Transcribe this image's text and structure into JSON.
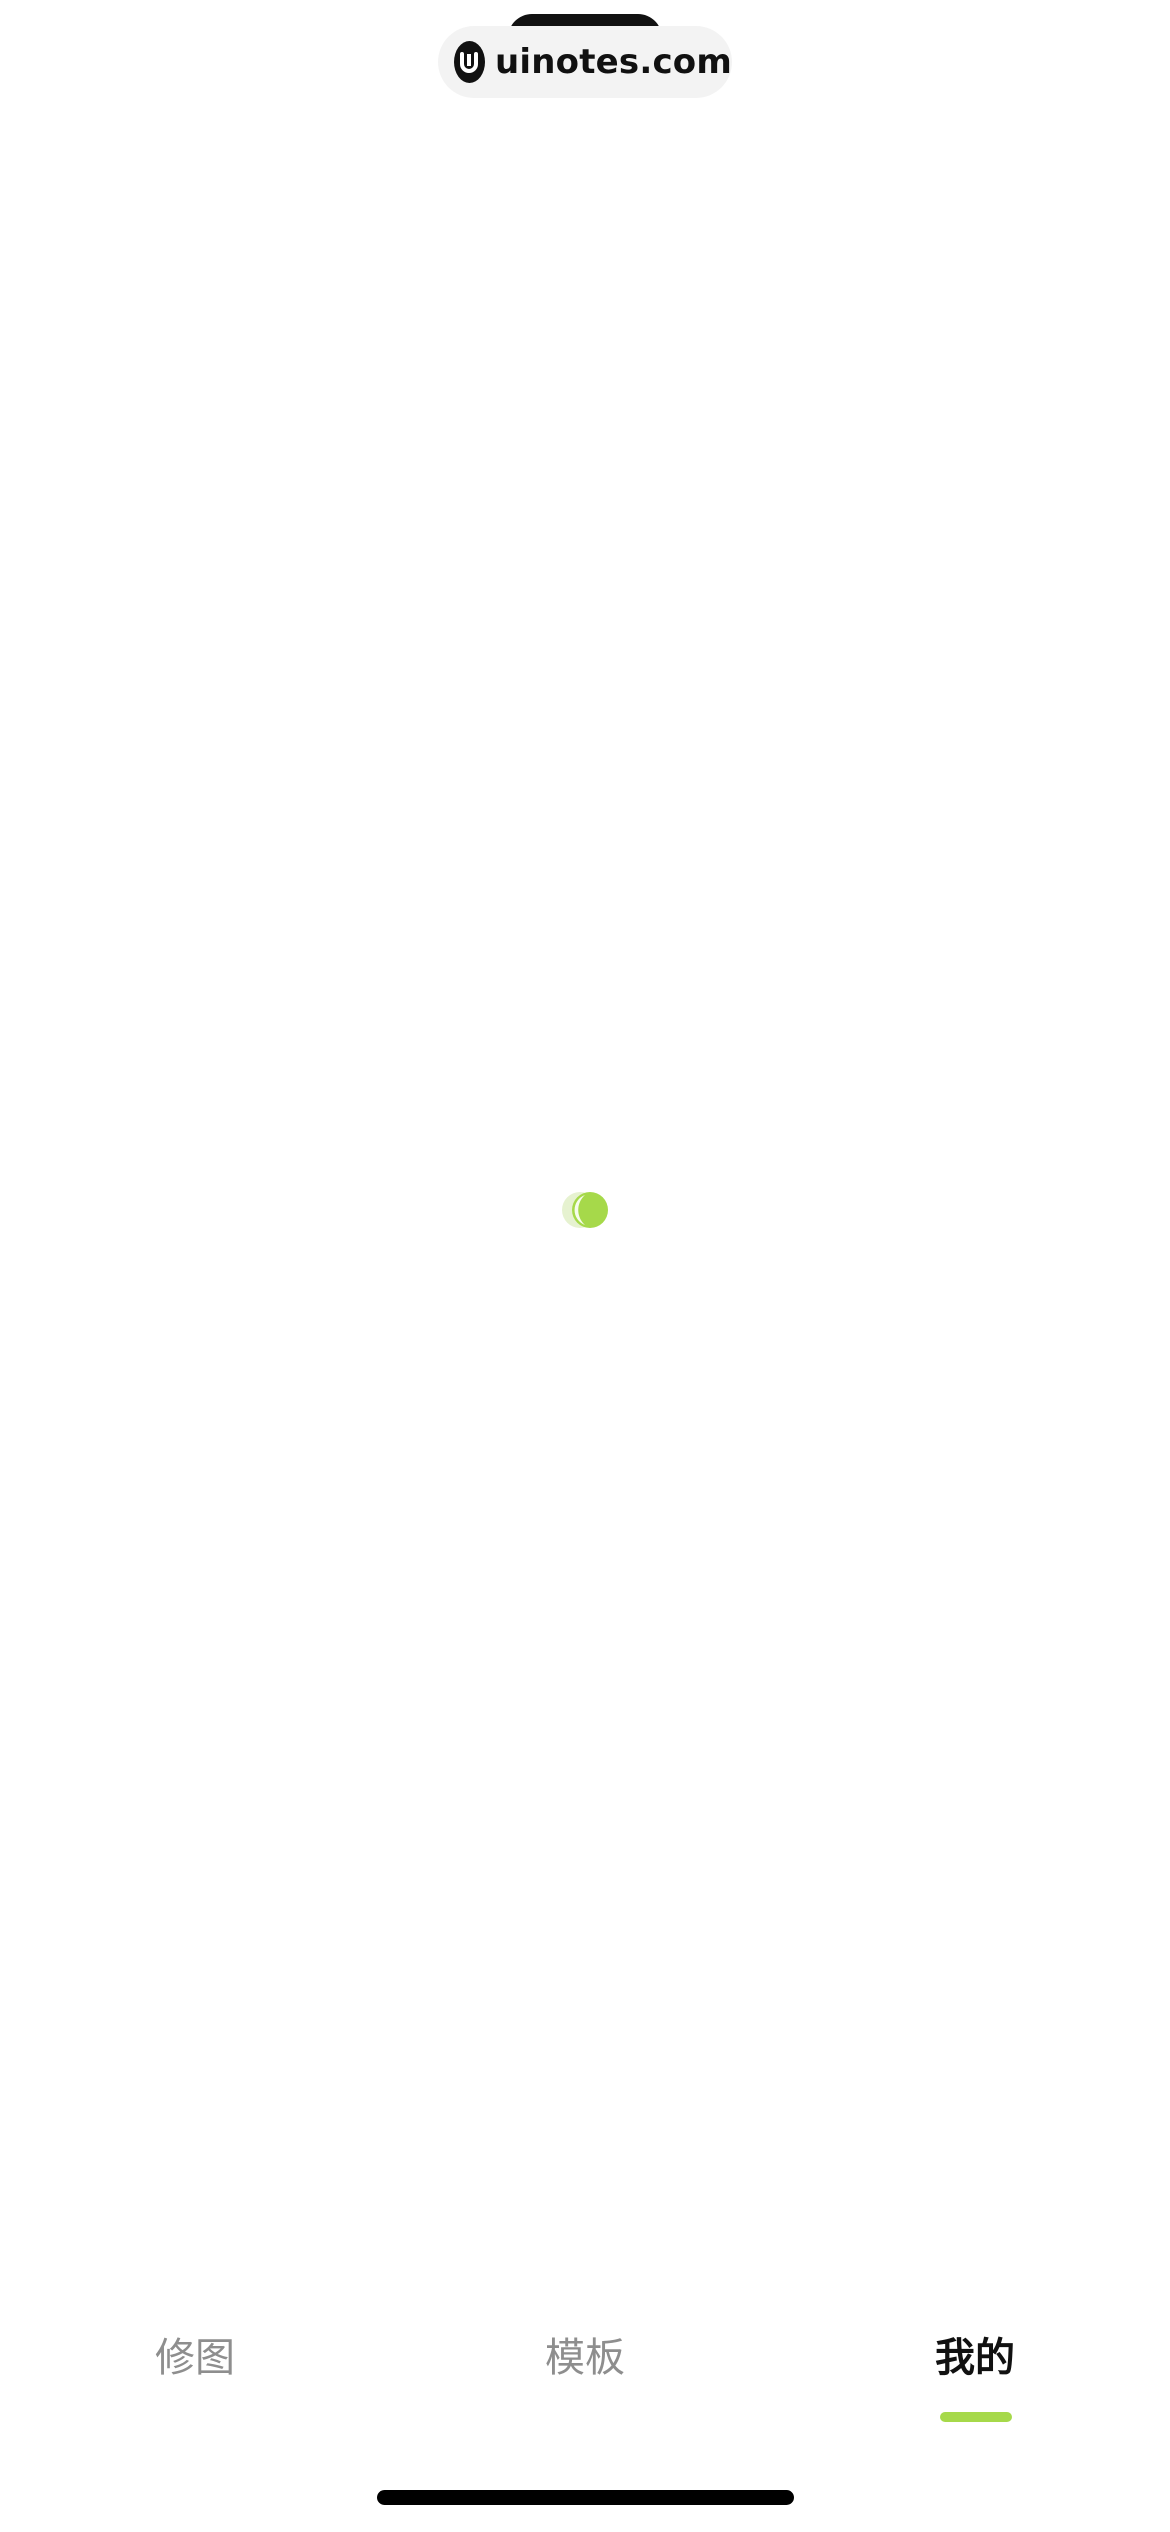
{
  "watermark": {
    "text": "uinotes.com"
  },
  "tabbar": {
    "tabs": [
      {
        "label": "修图",
        "active": false
      },
      {
        "label": "模板",
        "active": false
      },
      {
        "label": "我的",
        "active": true
      }
    ]
  },
  "colors": {
    "accent": "#a6d94a",
    "inactive_tab": "#8e8e8e",
    "active_tab": "#111111"
  },
  "icons": {
    "loading": "loading-spinner-icon",
    "watermark_logo": "uinotes-logo-icon"
  }
}
